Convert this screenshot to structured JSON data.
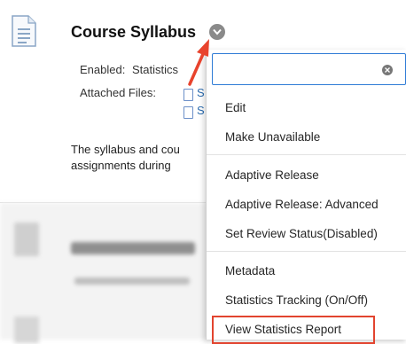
{
  "item": {
    "title": "Course Syllabus",
    "enabled_label": "Enabled:",
    "enabled_value": "Statistics",
    "attached_label": "Attached Files:",
    "file_1": "S",
    "file_2": "S",
    "description_line1": "The syllabus and cou",
    "description_line2": "assignments during"
  },
  "menu": {
    "search_value": "",
    "items": [
      "Edit",
      "Make Unavailable",
      "Adaptive Release",
      "Adaptive Release: Advanced",
      "Set Review Status(Disabled)",
      "Metadata",
      "Statistics Tracking (On/Off)",
      "View Statistics Report"
    ],
    "highlighted_item": "View Statistics Report"
  },
  "colors": {
    "highlight": "#e2442f",
    "arrow": "#e8432d",
    "link": "#2b6cb0",
    "search_border": "#2e7bd6"
  },
  "icons": {
    "document": "document-icon",
    "options": "chevron-down-icon",
    "clear": "clear-x-icon",
    "file": "file-icon",
    "annotation": "red-arrow"
  }
}
